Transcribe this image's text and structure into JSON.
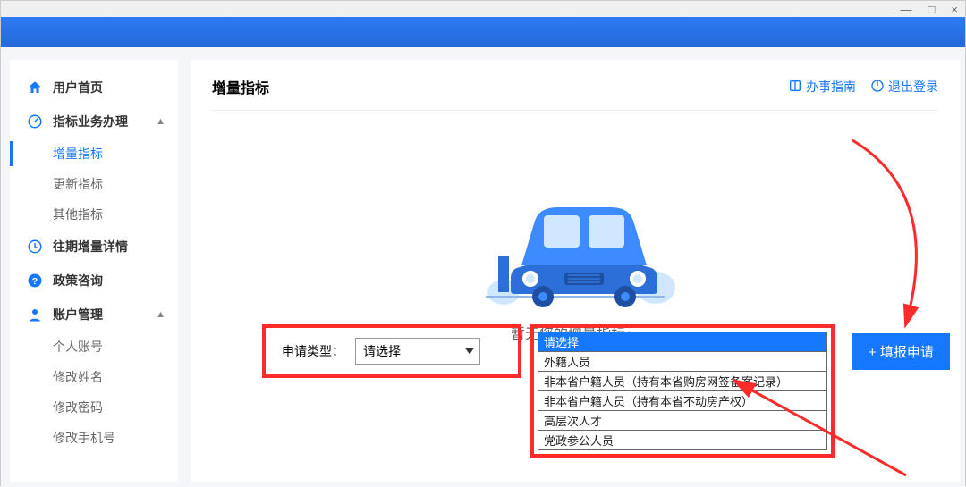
{
  "window": {
    "min": "—",
    "max": "□",
    "close": "×"
  },
  "sidebar": {
    "home": "用户首页",
    "section_indicator": "指标业务办理",
    "sub_increment": "增量指标",
    "sub_update": "更新指标",
    "sub_other": "其他指标",
    "history": "往期增量详情",
    "policy": "政策咨询",
    "account": "账户管理",
    "sub_personal": "个人账号",
    "sub_rename": "修改姓名",
    "sub_password": "修改密码",
    "sub_phone": "修改手机号"
  },
  "content": {
    "title": "增量指标",
    "guide": "办事指南",
    "logout": "退出登录",
    "nodata": "暂无您的增量指标～",
    "select_label": "申请类型：",
    "select_placeholder": "请选择",
    "submit": "+ 填报申请"
  },
  "options": {
    "o0": "请选择",
    "o1": "外籍人员",
    "o2": "非本省户籍人员（持有本省购房网签备案记录）",
    "o3": "非本省户籍人员（持有本省不动房产权）",
    "o4": "高层次人才",
    "o5": "党政参公人员"
  }
}
